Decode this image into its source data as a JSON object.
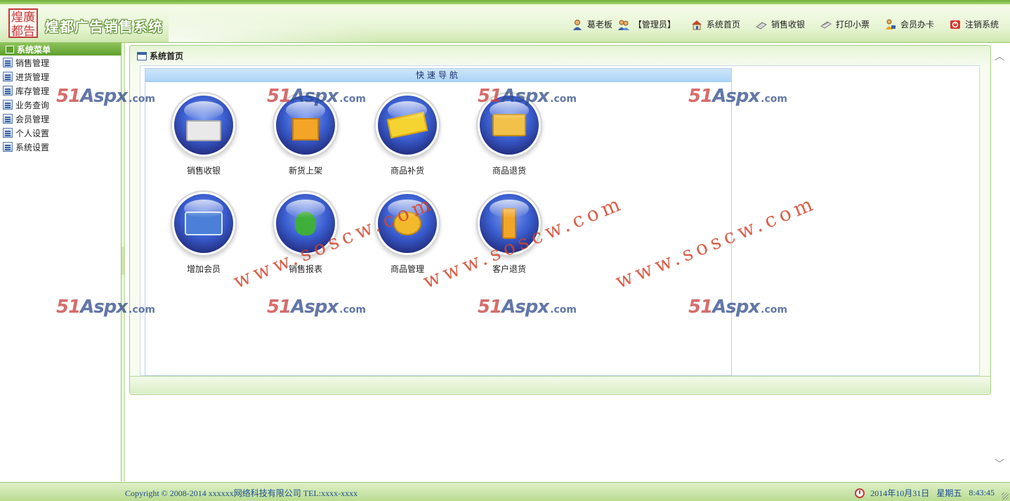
{
  "header": {
    "logo_seal_line1": "煌廣",
    "logo_seal_line2": "都告",
    "app_title": "煌都广告销售系统",
    "user_name": "葛老板",
    "user_role": "【管理员】",
    "nav": [
      {
        "label": "系统首页",
        "icon": "house-icon"
      },
      {
        "label": "销售收银",
        "icon": "cash-register-icon"
      },
      {
        "label": "打印小票",
        "icon": "printer-icon"
      },
      {
        "label": "会员办卡",
        "icon": "member-card-icon"
      },
      {
        "label": "注销系统",
        "icon": "logout-icon"
      }
    ]
  },
  "sidebar": {
    "title": "系统菜单",
    "items": [
      {
        "label": "销售管理"
      },
      {
        "label": "进货管理"
      },
      {
        "label": "库存管理"
      },
      {
        "label": "业务查询"
      },
      {
        "label": "会员管理"
      },
      {
        "label": "个人设置"
      },
      {
        "label": "系统设置"
      }
    ]
  },
  "main": {
    "panel_title": "系统首页",
    "quicknav_title": "快速导航",
    "tiles": [
      {
        "label": "销售收银",
        "icon": "cash-register-icon"
      },
      {
        "label": "新货上架",
        "icon": "new-goods-icon"
      },
      {
        "label": "商品补货",
        "icon": "restock-icon"
      },
      {
        "label": "商品退货",
        "icon": "goods-return-icon"
      },
      {
        "label": "增加会员",
        "icon": "add-member-icon"
      },
      {
        "label": "销售报表",
        "icon": "sales-report-icon"
      },
      {
        "label": "商品管理",
        "icon": "goods-manage-icon"
      },
      {
        "label": "客户退货",
        "icon": "customer-return-icon"
      }
    ]
  },
  "watermarks": {
    "aspx_prefix": "51",
    "aspx_word": "Aspx",
    "aspx_suffix": ".com",
    "soscw": "www.soscw.com"
  },
  "footer": {
    "copyright": "Copyright © 2008-2014 xxxxxx网络科技有限公司  TEL:xxxx-xxxx",
    "date": "2014年10月31日",
    "weekday": "星期五",
    "time": "8:43:45"
  },
  "colors": {
    "brand_green": "#6fae3a",
    "menu_header_green": "#5f9f2d",
    "quicknav_header_blue": "#a9d2f5",
    "footer_text_blue": "#1d4b8f",
    "watermark_red": "#c93c3c"
  }
}
